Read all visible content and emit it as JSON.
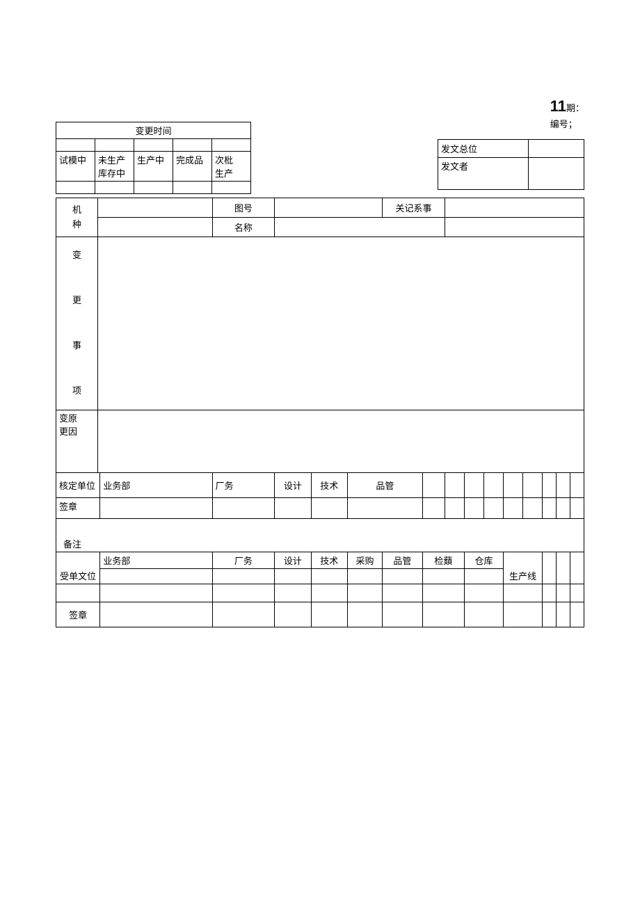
{
  "header": {
    "num": "11",
    "qi": "期：",
    "bianhao": "编号；"
  },
  "sender": {
    "unit_label": "发文总位",
    "person_label": "发文者"
  },
  "changetime": {
    "title": "变更时间",
    "c1": "试模中",
    "c2a": "未生产",
    "c2b": "库存中",
    "c3": "生产中",
    "c4": "完成品",
    "c5a": "次枇",
    "c5b": "生产"
  },
  "main": {
    "machine_label": "机\n种",
    "drawing_label": "图号",
    "name_label": "名称",
    "related_label": "关记系事",
    "change_items_label": "变\n\n更\n\n事\n\n项",
    "change_reason_left": "变原",
    "change_reason_left2": "更因",
    "approve_unit": "核定单位",
    "dept_business": "业务部",
    "dept_factory": "厂务",
    "dept_design": "设计",
    "dept_tech": "技术",
    "dept_qc": "品管",
    "signature": "签章",
    "remark": "备注",
    "recv_unit": "受单文位",
    "dept_purchase": "采购",
    "dept_inspect": "检蘱",
    "dept_warehouse": "仓库",
    "dept_line": "生产线"
  }
}
